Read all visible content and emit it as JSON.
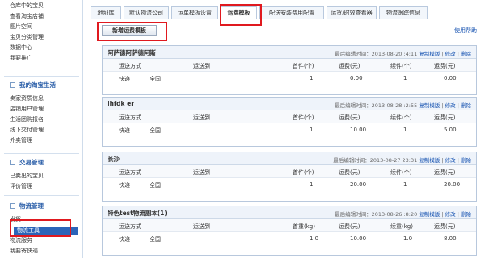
{
  "sidebar": {
    "top_items": [
      "仓库中的宝贝",
      "查看淘宝店铺",
      "图片空间",
      "宝贝分类管理",
      "数据中心",
      "我要推广"
    ],
    "section1_title": "我的淘宝生活",
    "section1_items": [
      "卖家资质信息",
      "店铺用户管理",
      "生活团购报名",
      "线下交付管理",
      "外卖管理"
    ],
    "section2_title": "交易管理",
    "section2_items": [
      "已卖出的宝贝",
      "评价管理"
    ],
    "section3_title": "物流管理",
    "section3_items": [
      "发货",
      "物流工具",
      "物流服务",
      "我要寄快递"
    ]
  },
  "tabs": [
    "地址库",
    "默认物流公司",
    "运单模板设置",
    "运费模板",
    "配送安装费用配置",
    "运货/时效查看器",
    "物流跟踪信息"
  ],
  "new_template_button": "新增运费模板",
  "help_link": "使用帮助",
  "columns": [
    "运送方式",
    "运送到",
    "首件(个)",
    "运费(元)",
    "续件(个)",
    "运费(元)"
  ],
  "columns_weight": [
    "运送方式",
    "运送到",
    "首重(kg)",
    "运费(元)",
    "续重(kg)",
    "运费(元)"
  ],
  "action_copy": "复制模版",
  "action_edit": "修改",
  "action_delete": "删除",
  "templates": [
    {
      "name": "阿萨德阿萨德阿斯",
      "meta": "最后编辑时间：2013-08-20 :4:11",
      "method": "快递",
      "dest": "全国",
      "first": "1",
      "fee": "0.00",
      "next": "1",
      "next_fee": "0.00"
    },
    {
      "name": "ihfdk er",
      "meta": "最后编辑时间：2013-08-28 :2:55",
      "method": "快递",
      "dest": "全国",
      "first": "1",
      "fee": "10.00",
      "next": "1",
      "next_fee": "5.00"
    },
    {
      "name": "长沙",
      "meta": "最后编辑时间：2013-08-27 23:31",
      "method": "快递",
      "dest": "全国",
      "first": "1",
      "fee": "20.00",
      "next": "1",
      "next_fee": "20.00"
    },
    {
      "name": "特色test物流副本(1)",
      "meta": "最后编辑时间：2013-08-26 :8:20",
      "method": "快递",
      "dest": "全国",
      "first": "1.0",
      "fee": "10.00",
      "next": "1.0",
      "next_fee": "8.00"
    }
  ]
}
